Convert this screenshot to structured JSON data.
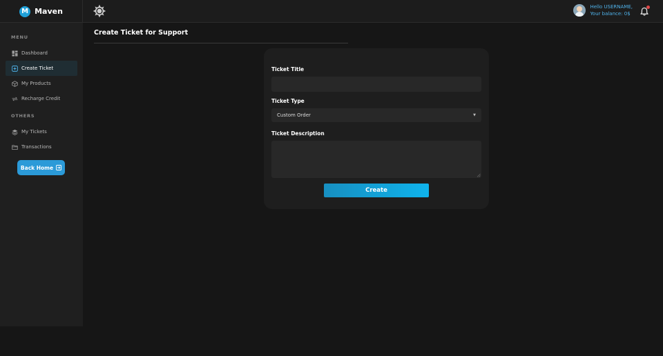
{
  "brand": {
    "logo_letter": "M",
    "name": "Maven"
  },
  "header": {
    "greeting": "Hello USERNAME,",
    "balance": "Your balance: 0$"
  },
  "sidebar": {
    "menu_label": "MENU",
    "others_label": "OTHERS",
    "items": [
      {
        "label": "Dashboard",
        "icon": "dashboard-icon"
      },
      {
        "label": "Create Ticket",
        "icon": "plus-square-icon",
        "active": true
      },
      {
        "label": "My Products",
        "icon": "box-icon"
      },
      {
        "label": "Recharge Credit",
        "icon": "refresh-icon"
      }
    ],
    "others": [
      {
        "label": "My Tickets",
        "icon": "layers-icon"
      },
      {
        "label": "Transactions",
        "icon": "folder-icon"
      }
    ],
    "back_home": "Back Home"
  },
  "main": {
    "title": "Create Ticket for Support",
    "form": {
      "ticket_title_label": "Ticket Title",
      "ticket_title_value": "",
      "ticket_type_label": "Ticket Type",
      "ticket_type_value": "Custom Order",
      "ticket_description_label": "Ticket Description",
      "ticket_description_value": "",
      "submit_label": "Create"
    }
  },
  "colors": {
    "accent": "#2b9ad8",
    "button_gradient_start": "#178fc1",
    "button_gradient_end": "#0fb3ec",
    "user_text": "#4fb2ea",
    "notification_dot": "#e04848"
  }
}
